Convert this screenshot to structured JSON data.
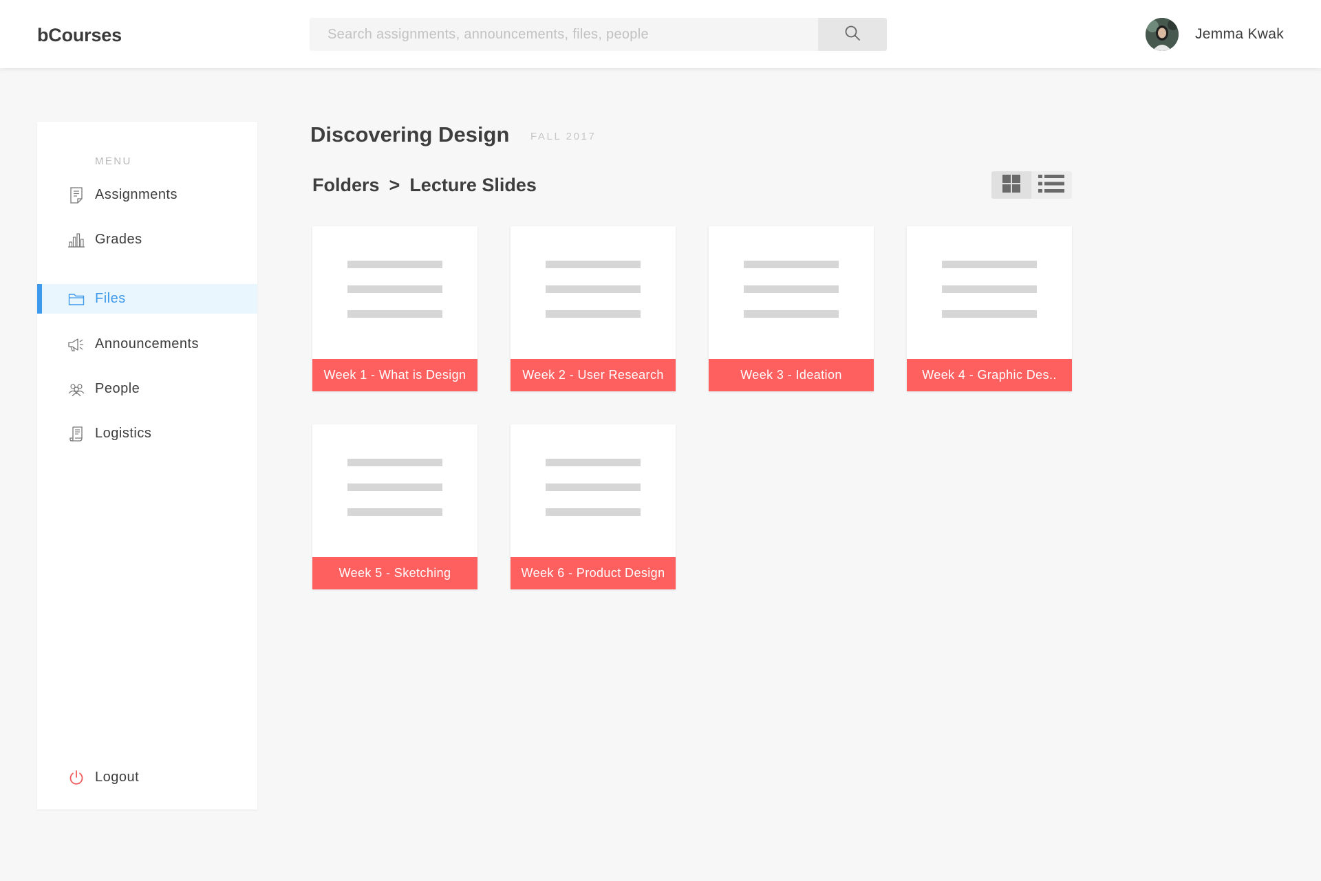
{
  "header": {
    "brand": "bCourses",
    "search_placeholder": "Search assignments, announcements, files, people",
    "user_name": "Jemma Kwak"
  },
  "sidebar": {
    "menu_title": "MENU",
    "items": [
      {
        "label": "Assignments",
        "icon": "document-icon"
      },
      {
        "label": "Grades",
        "icon": "bar-chart-icon"
      },
      {
        "label": "Files",
        "icon": "folder-icon",
        "active": true
      },
      {
        "label": "Announcements",
        "icon": "megaphone-icon"
      },
      {
        "label": "People",
        "icon": "people-icon"
      },
      {
        "label": "Logistics",
        "icon": "scroll-icon"
      }
    ],
    "logout_label": "Logout"
  },
  "main": {
    "course_title": "Discovering Design",
    "term": "FALL 2017",
    "breadcrumb": [
      "Folders",
      ">",
      "Lecture Slides"
    ],
    "view_modes": [
      "grid-view-icon",
      "list-view-icon"
    ],
    "folders": [
      {
        "label": "Week 1 - What is Design"
      },
      {
        "label": "Week 2 - User Research"
      },
      {
        "label": "Week 3 - Ideation"
      },
      {
        "label": "Week 4 - Graphic Des.."
      },
      {
        "label": "Week 5 - Sketching"
      },
      {
        "label": "Week 6 - Product Design"
      }
    ]
  },
  "colors": {
    "accent": "#3d99ec",
    "card_label": "#fe5f5f",
    "logout_icon": "#f05a5a"
  }
}
